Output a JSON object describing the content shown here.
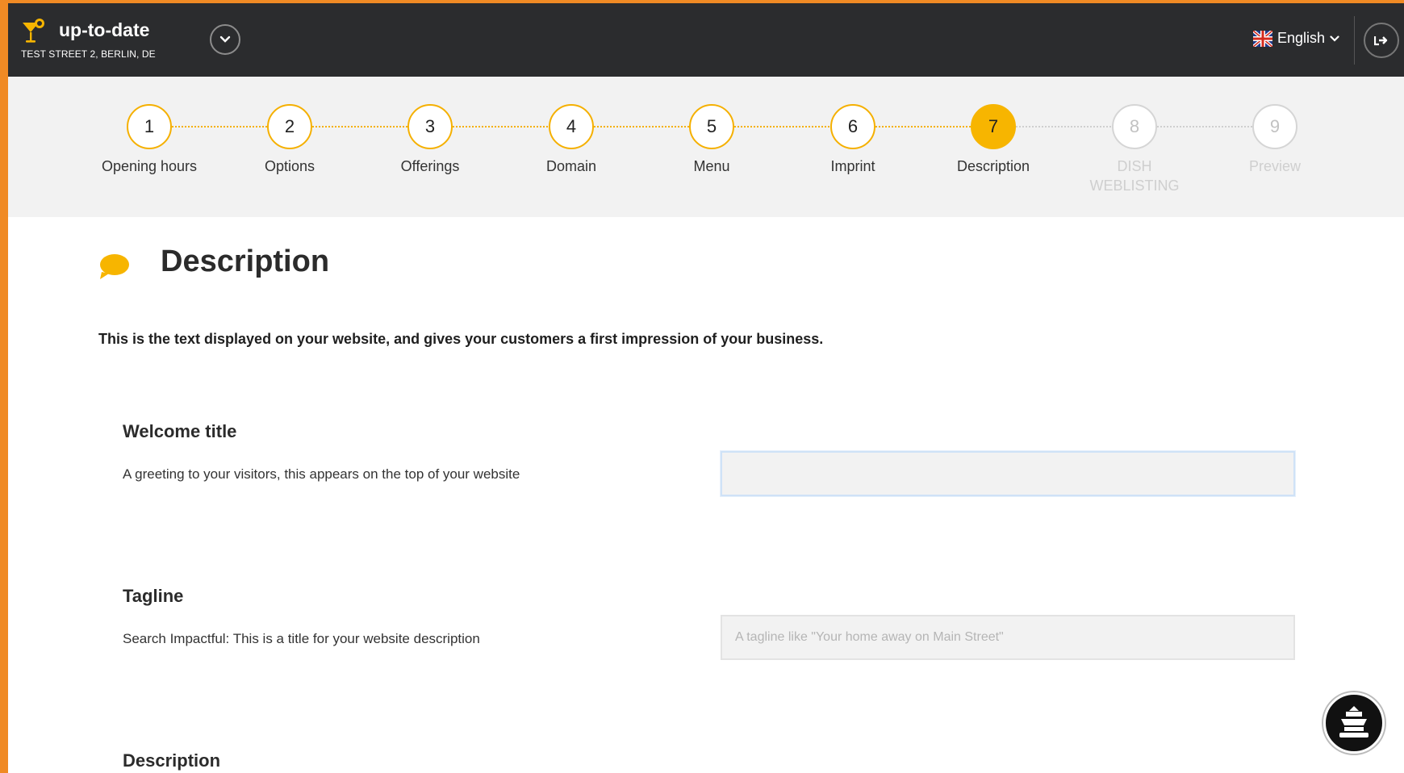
{
  "header": {
    "brand_name": "up-to-date",
    "address": "TEST STREET 2, BERLIN, DE",
    "language": "English",
    "colors": {
      "bar": "#2b2c2e",
      "accent": "#f7b500",
      "frame": "#f08a24"
    },
    "icons": [
      "cocktail-logo-icon",
      "chevron-down-icon",
      "uk-flag-icon",
      "logout-icon"
    ]
  },
  "stepper": {
    "steps": [
      {
        "number": "1",
        "label": "Opening hours",
        "state": "done"
      },
      {
        "number": "2",
        "label": "Options",
        "state": "done"
      },
      {
        "number": "3",
        "label": "Offerings",
        "state": "done"
      },
      {
        "number": "4",
        "label": "Domain",
        "state": "done"
      },
      {
        "number": "5",
        "label": "Menu",
        "state": "done"
      },
      {
        "number": "6",
        "label": "Imprint",
        "state": "done"
      },
      {
        "number": "7",
        "label": "Description",
        "state": "active"
      },
      {
        "number": "8",
        "label": "DISH WEBLISTING",
        "state": "disabled"
      },
      {
        "number": "9",
        "label": "Preview",
        "state": "disabled"
      }
    ]
  },
  "content": {
    "title": "Description",
    "intro": "This is the text displayed on your website, and gives your customers a first impression of your business.",
    "sections": {
      "welcome": {
        "title": "Welcome title",
        "description": "A greeting to your visitors, this appears on the top of your website",
        "value": "",
        "placeholder": ""
      },
      "tagline": {
        "title": "Tagline",
        "description": "Search Impactful: This is a title for your website description",
        "value": "",
        "placeholder": "A tagline like \"Your home away on Main Street\""
      },
      "description": {
        "title": "Description"
      }
    }
  }
}
